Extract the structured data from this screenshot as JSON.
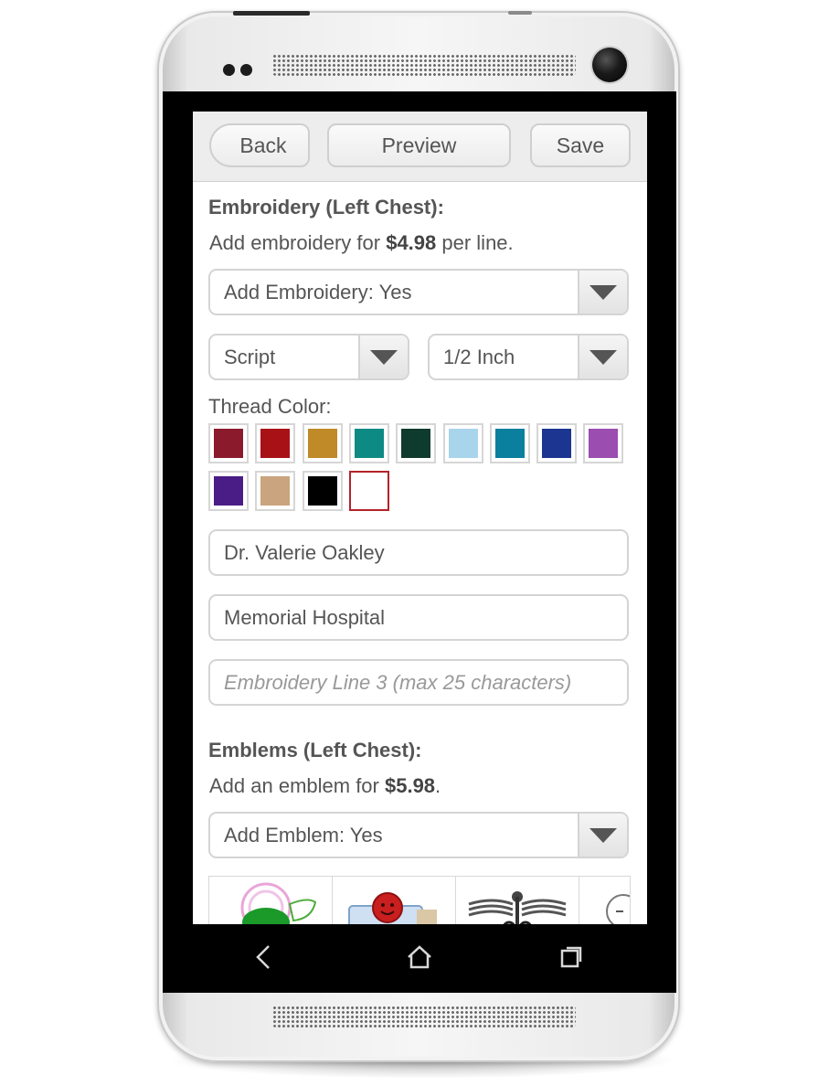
{
  "toolbar": {
    "back_label": "Back",
    "preview_label": "Preview",
    "save_label": "Save"
  },
  "embroidery": {
    "title": "Embroidery (Left Chest):",
    "subtitle_prefix": "Add embroidery for ",
    "price": "$4.98",
    "subtitle_suffix": " per line.",
    "add_select": "Add Embroidery: Yes",
    "font_select": "Script",
    "size_select": "1/2 Inch",
    "thread_label": "Thread Color:",
    "thread_colors": [
      "#8a1a2c",
      "#a81217",
      "#bf8a27",
      "#0e8a84",
      "#0f3b2e",
      "#a8d4ec",
      "#0b7f9e",
      "#1c3591",
      "#9b4db0",
      "#4a1d86",
      "#c9a47e",
      "#000000",
      "#ffffff"
    ],
    "selected_color_index": 12,
    "line1_value": "Dr. Valerie Oakley",
    "line2_value": "Memorial Hospital",
    "line3_placeholder": "Embroidery Line 3 (max 25 characters)"
  },
  "emblems": {
    "title": "Emblems (Left Chest):",
    "subtitle_prefix": "Add an emblem for ",
    "price": "$5.98",
    "subtitle_suffix": ".",
    "add_select": "Add Emblem: Yes",
    "items": [
      "floral-emblem",
      "smiley-emblem",
      "caduceus-emblem",
      "clock-emblem"
    ]
  },
  "android_nav": [
    "back-icon",
    "home-icon",
    "recent-apps-icon"
  ]
}
